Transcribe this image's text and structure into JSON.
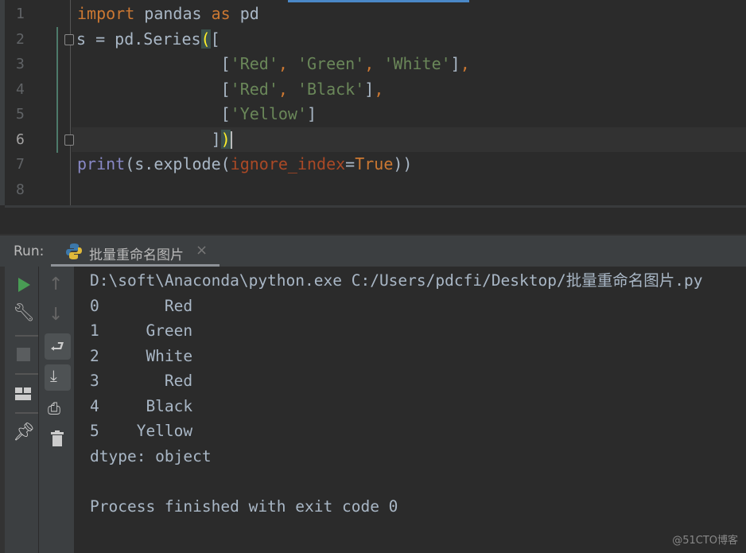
{
  "editor": {
    "line_numbers": [
      "1",
      "2",
      "3",
      "4",
      "5",
      "6",
      "7",
      "8"
    ],
    "lines": [
      [
        {
          "t": "import",
          "c": "kw"
        },
        {
          "t": " pandas "
        },
        {
          "t": "as",
          "c": "kw"
        },
        {
          "t": " pd"
        }
      ],
      [
        {
          "t": "s = pd.Series"
        },
        {
          "t": "(",
          "c": "brace"
        },
        {
          "t": "["
        }
      ],
      [
        {
          "t": "               ["
        },
        {
          "t": "'Red'",
          "c": "str"
        },
        {
          "t": ", ",
          "c": "kw"
        },
        {
          "t": "'Green'",
          "c": "str"
        },
        {
          "t": ", ",
          "c": "kw"
        },
        {
          "t": "'White'",
          "c": "str"
        },
        {
          "t": "]"
        },
        {
          "t": ",",
          "c": "kw"
        }
      ],
      [
        {
          "t": "               ["
        },
        {
          "t": "'Red'",
          "c": "str"
        },
        {
          "t": ", ",
          "c": "kw"
        },
        {
          "t": "'Black'",
          "c": "str"
        },
        {
          "t": "]"
        },
        {
          "t": ",",
          "c": "kw"
        }
      ],
      [
        {
          "t": "               ["
        },
        {
          "t": "'Yellow'",
          "c": "str"
        },
        {
          "t": "]"
        }
      ],
      [
        {
          "t": "              ]"
        },
        {
          "t": ")",
          "c": "brace"
        }
      ],
      [
        {
          "t": "print",
          "c": "bi"
        },
        {
          "t": "(s.explode("
        },
        {
          "t": "ignore_index",
          "c": "param"
        },
        {
          "t": "="
        },
        {
          "t": "True",
          "c": "kw"
        },
        {
          "t": "))"
        }
      ],
      []
    ]
  },
  "run": {
    "label": "Run:",
    "tab_title": "批量重命名图片",
    "close": "×"
  },
  "console": {
    "lines": [
      "D:\\soft\\Anaconda\\python.exe C:/Users/pdcfi/Desktop/批量重命名图片.py",
      "0       Red",
      "1     Green",
      "2     White",
      "3       Red",
      "4     Black",
      "5    Yellow",
      "dtype: object",
      "",
      "Process finished with exit code 0"
    ]
  },
  "colors": {
    "keyword": "#cc7832",
    "string": "#6a8759",
    "param": "#aa4926",
    "builtin": "#8888c6",
    "run_green": "#499c54"
  },
  "watermark": "@51CTO博客"
}
